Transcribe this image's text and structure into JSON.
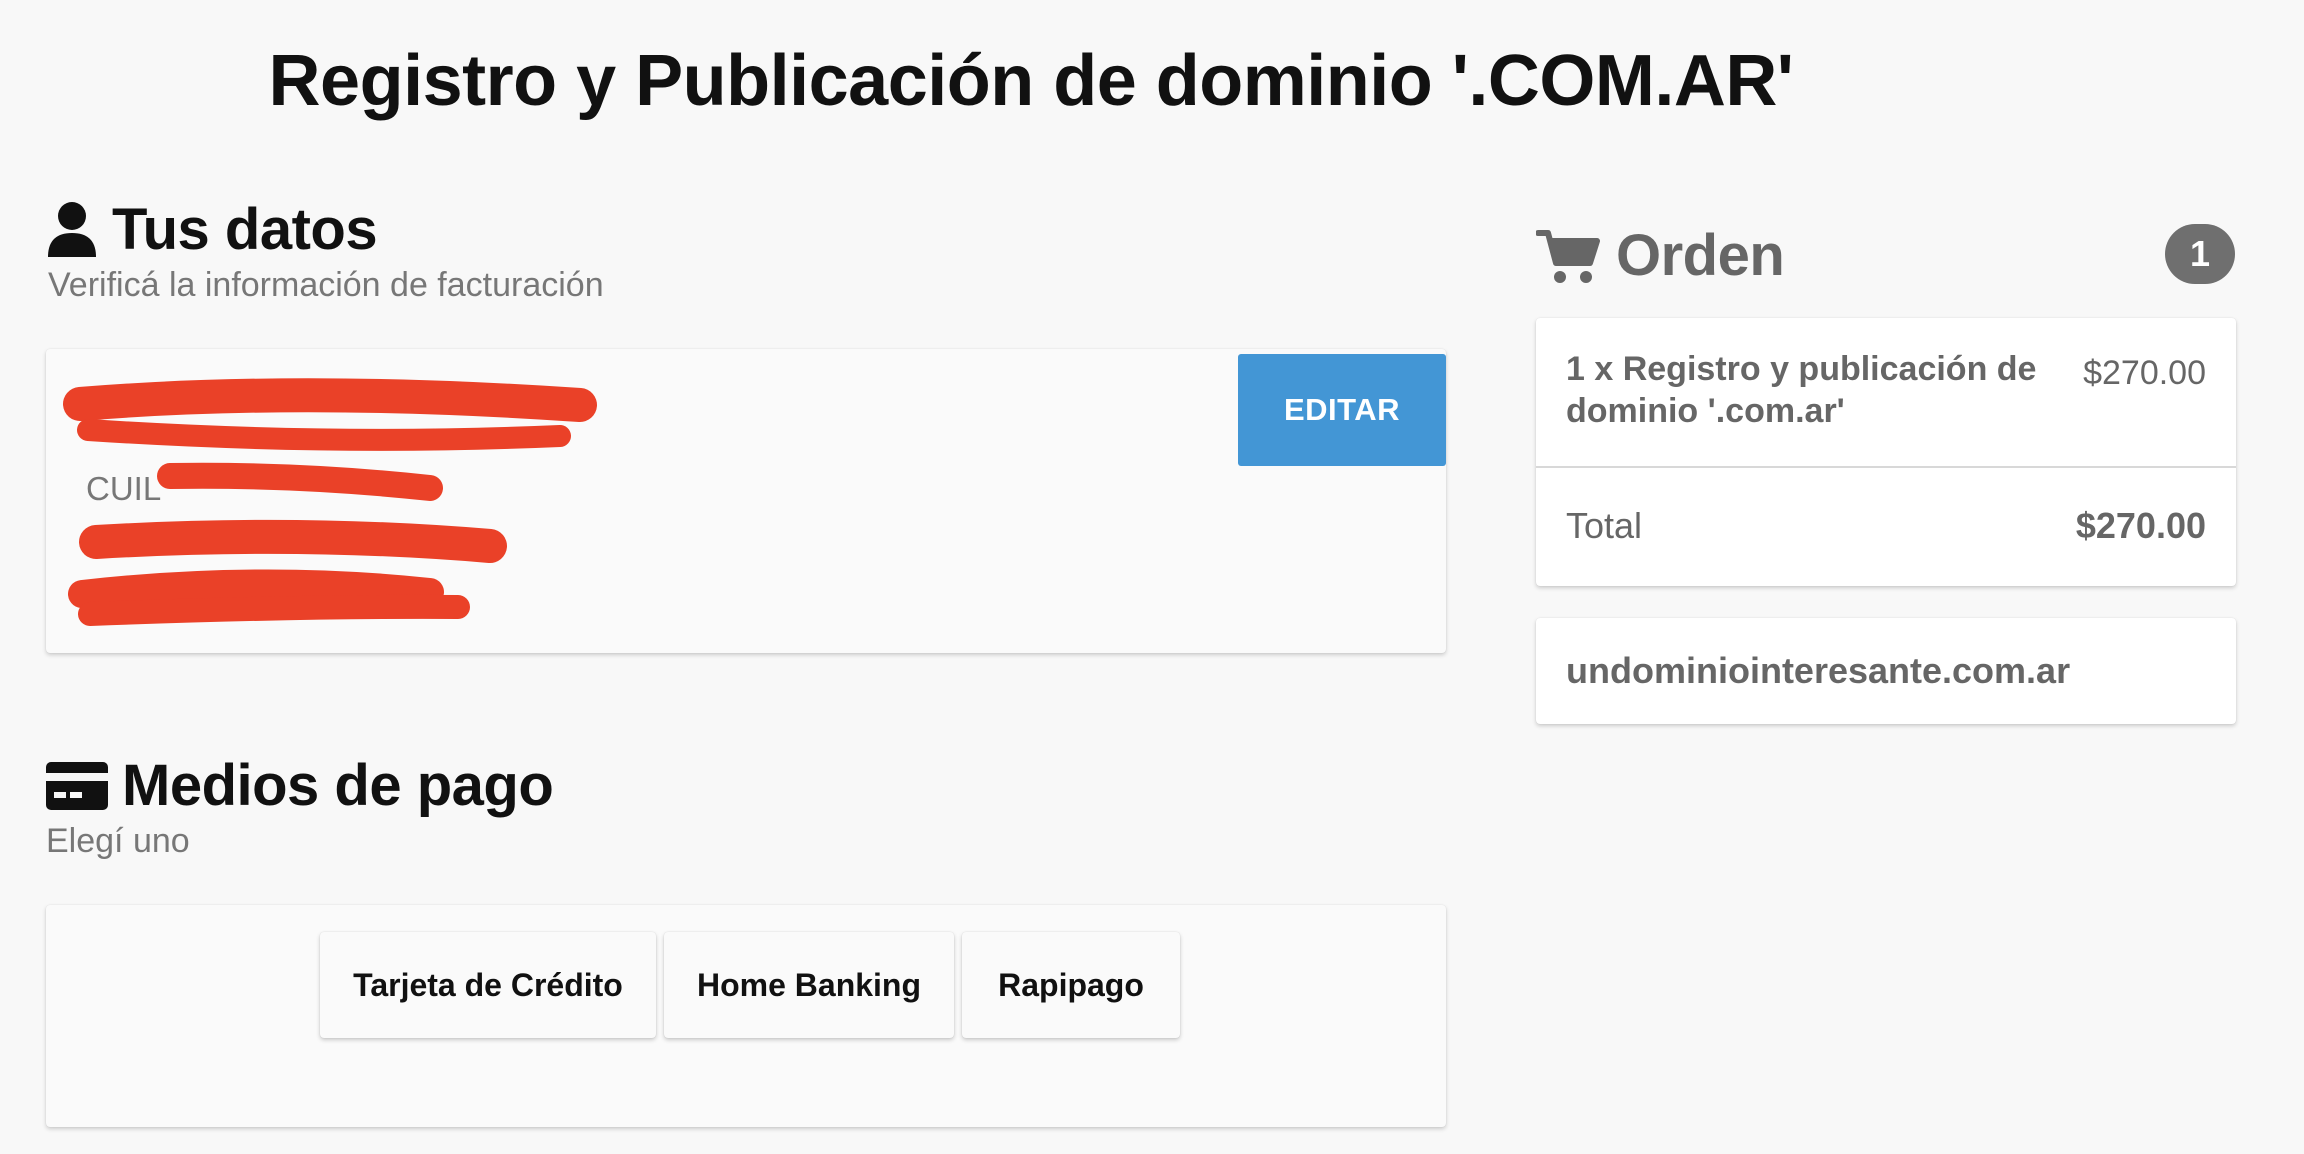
{
  "page": {
    "title": "Registro y Publicación de dominio '.COM.AR'"
  },
  "datos": {
    "icon": "user-icon",
    "heading": "Tus datos",
    "subtitle": "Verificá la información de facturación",
    "cuil_label": "CUIL",
    "edit_label": "EDITAR",
    "redaction_color": "#ea4128"
  },
  "pago": {
    "icon": "credit-card-icon",
    "heading": "Medios de pago",
    "subtitle": "Elegí uno",
    "methods": [
      {
        "label": "Tarjeta de Crédito"
      },
      {
        "label": "Home Banking"
      },
      {
        "label": "Rapipago"
      }
    ]
  },
  "orden": {
    "icon": "cart-icon",
    "heading": "Orden",
    "count": "1",
    "item": {
      "name": "1 x Registro y publicación de dominio '.com.ar'",
      "price": "$270.00"
    },
    "total_label": "Total",
    "total_value": "$270.00",
    "domain": "undominiointeresante.com.ar"
  },
  "colors": {
    "accent": "#4396d5",
    "badge": "#6f6f6f",
    "background": "#f8f8f8"
  }
}
